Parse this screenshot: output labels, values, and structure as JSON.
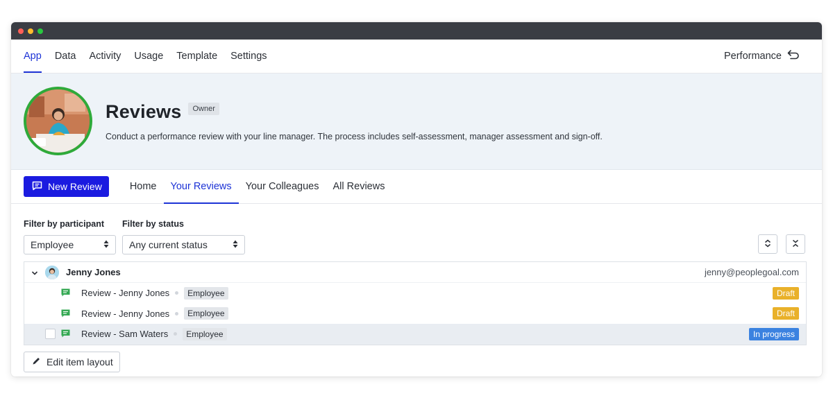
{
  "colors": {
    "accent": "#1d33d6",
    "primary_button": "#1b1be0",
    "avatar_ring": "#2faa3a",
    "draft": "#e9b12a",
    "in_progress": "#3b82e0",
    "dot_red": "#ff5f57",
    "dot_yellow": "#febc2e",
    "dot_green": "#28c840"
  },
  "top_nav": {
    "tabs": [
      {
        "label": "App",
        "active": true
      },
      {
        "label": "Data"
      },
      {
        "label": "Activity"
      },
      {
        "label": "Usage"
      },
      {
        "label": "Template"
      },
      {
        "label": "Settings"
      }
    ],
    "right_label": "Performance",
    "right_icon": "return-arrow-icon"
  },
  "hero": {
    "title": "Reviews",
    "badge": "Owner",
    "description": "Conduct a performance review with your line manager. The process includes self-assessment, manager assessment and sign-off."
  },
  "sub_nav": {
    "new_button": "New Review",
    "tabs": [
      {
        "label": "Home"
      },
      {
        "label": "Your Reviews",
        "active": true
      },
      {
        "label": "Your Colleagues"
      },
      {
        "label": "All Reviews"
      }
    ]
  },
  "filters": {
    "participant_label": "Filter by participant",
    "participant_value": "Employee",
    "status_label": "Filter by status",
    "status_value": "Any current status"
  },
  "list": {
    "group": {
      "name": "Jenny Jones",
      "email": "jenny@peoplegoal.com"
    },
    "items": [
      {
        "title": "Review - Jenny Jones",
        "role": "Employee",
        "status": "Draft",
        "checkbox": false
      },
      {
        "title": "Review - Jenny Jones",
        "role": "Employee",
        "status": "Draft",
        "checkbox": false
      },
      {
        "title": "Review - Sam Waters",
        "role": "Employee",
        "status": "In progress",
        "checkbox": true
      }
    ]
  },
  "edit_button": "Edit item layout"
}
